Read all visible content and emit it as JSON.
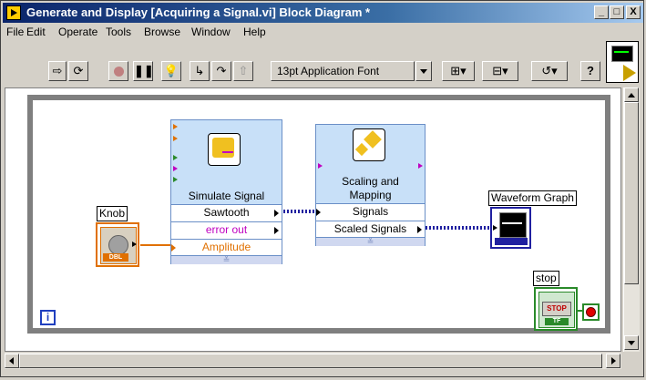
{
  "window": {
    "title": "Generate and Display [Acquiring a Signal.vi] Block Diagram *",
    "controls": [
      "_",
      "□",
      "X"
    ]
  },
  "menu": [
    "File",
    "Edit",
    "Operate",
    "Tools",
    "Browse",
    "Window",
    "Help"
  ],
  "toolbar": {
    "font_label": "13pt Application Font",
    "buttons": [
      "run-arrow-icon",
      "run-continuously-icon",
      "abort-icon",
      "pause-icon",
      "highlight-execution-icon",
      "step-into-icon",
      "step-over-icon",
      "step-out-icon",
      "align-icon",
      "distribute-icon",
      "reorder-icon",
      "help-icon"
    ]
  },
  "diagram": {
    "simulate_signal": {
      "title": "Simulate Signal",
      "rows": [
        "Sawtooth",
        "error out",
        "Amplitude"
      ]
    },
    "scaling": {
      "title_line1": "Scaling and",
      "title_line2": "Mapping",
      "rows": [
        "Signals",
        "Scaled Signals"
      ]
    },
    "knob_label": "Knob",
    "knob_type": "DBL",
    "graph_label": "Waveform Graph",
    "stop_label": "stop",
    "stop_button": "STOP",
    "stop_type": "TF",
    "iteration": "i"
  },
  "colors": {
    "orange": "#e07000",
    "blue_wire": "#2020a0",
    "green": "#2a8a2a",
    "express_fill": "#c8e0f8"
  }
}
